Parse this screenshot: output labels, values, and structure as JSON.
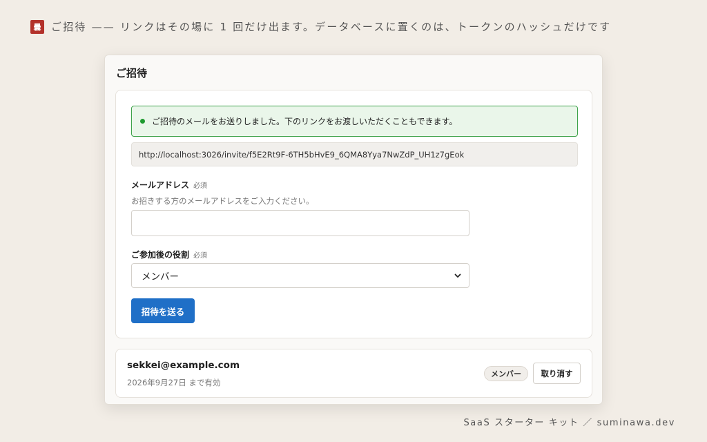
{
  "header": {
    "logo_glyph": "曇",
    "text": "ご招待 —— リンクはその場に 1 回だけ出ます。データベースに置くのは、トークンのハッシュだけです"
  },
  "panel": {
    "title": "ご招待"
  },
  "alert": {
    "message": "ご招待のメールをお送りしました。下のリンクをお渡しいただくこともできます。",
    "color": "#1e9a2f"
  },
  "invite_link": "http://localhost:3026/invite/f5E2Rt9F-6TH5bHvE9_6QMA8Yya7NwZdP_UH1z7gEok",
  "form": {
    "email_label": "メールアドレス",
    "email_required": "必須",
    "email_hint": "お招きする方のメールアドレスをご入力ください。",
    "email_value": "",
    "role_label": "ご参加後の役割",
    "role_required": "必須",
    "role_selected": "メンバー",
    "submit_label": "招待を送る",
    "accent_color": "#1f6fc7"
  },
  "invites": [
    {
      "email": "sekkei@example.com",
      "expiry": "2026年9月27日 まで有効",
      "role": "メンバー",
      "revoke_label": "取り消す"
    }
  ],
  "footer": "SaaS スターター キット ／ suminawa.dev"
}
